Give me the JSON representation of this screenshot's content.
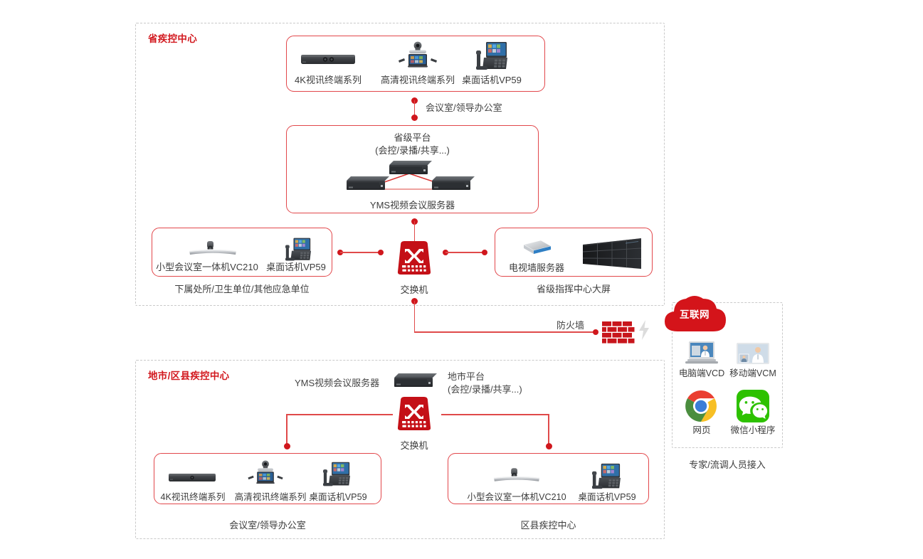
{
  "colors": {
    "brand_red": "#d0171d",
    "line_red": "#e04a4a",
    "group_border": "#e2474b",
    "zone_border": "#c9c9c9",
    "caption": "#3c3c3c",
    "wechat_green": "#2dc100"
  },
  "zones": {
    "province": {
      "title": "省疾控中心"
    },
    "city": {
      "title": "地市/区县疾控中心"
    },
    "internet_panel": {
      "caption": "专家/流调人员接入"
    }
  },
  "province": {
    "top_group": {
      "devices": [
        {
          "label": "4K视讯终端系列",
          "icon": "soundbar-4k-icon"
        },
        {
          "label": "高清视讯终端系列",
          "icon": "hd-codec-icon"
        },
        {
          "label": "桌面话机VP59",
          "icon": "desk-phone-icon"
        }
      ]
    },
    "link_top_label": "会议室/领导办公室",
    "platform": {
      "title": "省级平台",
      "subtitle": "(会控/录播/共享...)",
      "server_label": "YMS视频会议服务器"
    },
    "left_group": {
      "devices": [
        {
          "label": "小型会议室一体机VC210",
          "icon": "vc210-icon"
        },
        {
          "label": "桌面话机VP59",
          "icon": "desk-phone-icon"
        }
      ],
      "caption": "下属处所/卫生单位/其他应急单位"
    },
    "switch": {
      "label": "交换机",
      "icon": "network-switch-icon"
    },
    "right_group": {
      "devices": [
        {
          "label": "电视墙服务器",
          "icon": "tv-wall-server-icon"
        },
        {
          "label": "",
          "icon": "video-wall-icon"
        }
      ],
      "caption": "省级指挥中心大屏"
    }
  },
  "firewall": {
    "label": "防火墙",
    "icon": "firewall-brick-icon",
    "bolt_icon": "lightning-bolt-icon"
  },
  "internet": {
    "cloud_label": "互联网",
    "items": [
      {
        "label": "电脑端VCD",
        "icon": "laptop-vcd-icon"
      },
      {
        "label": "移动端VCM",
        "icon": "tablet-vcm-icon"
      },
      {
        "label": "网页",
        "icon": "chrome-browser-icon"
      },
      {
        "label": "微信小程序",
        "icon": "wechat-miniprogram-icon"
      }
    ]
  },
  "city": {
    "server_label": "YMS视频会议服务器",
    "platform": {
      "title": "地市平台",
      "subtitle": "(会控/录播/共享...)"
    },
    "switch": {
      "label": "交换机",
      "icon": "network-switch-icon"
    },
    "left_group": {
      "devices": [
        {
          "label": "4K视讯终端系列",
          "icon": "soundbar-4k-icon"
        },
        {
          "label": "高清视讯终端系列",
          "icon": "hd-codec-icon"
        },
        {
          "label": "桌面话机VP59",
          "icon": "desk-phone-icon"
        }
      ],
      "caption": "会议室/领导办公室"
    },
    "right_group": {
      "devices": [
        {
          "label": "小型会议室一体机VC210",
          "icon": "vc210-icon"
        },
        {
          "label": "桌面话机VP59",
          "icon": "desk-phone-icon"
        }
      ],
      "caption": "区县疾控中心"
    }
  }
}
